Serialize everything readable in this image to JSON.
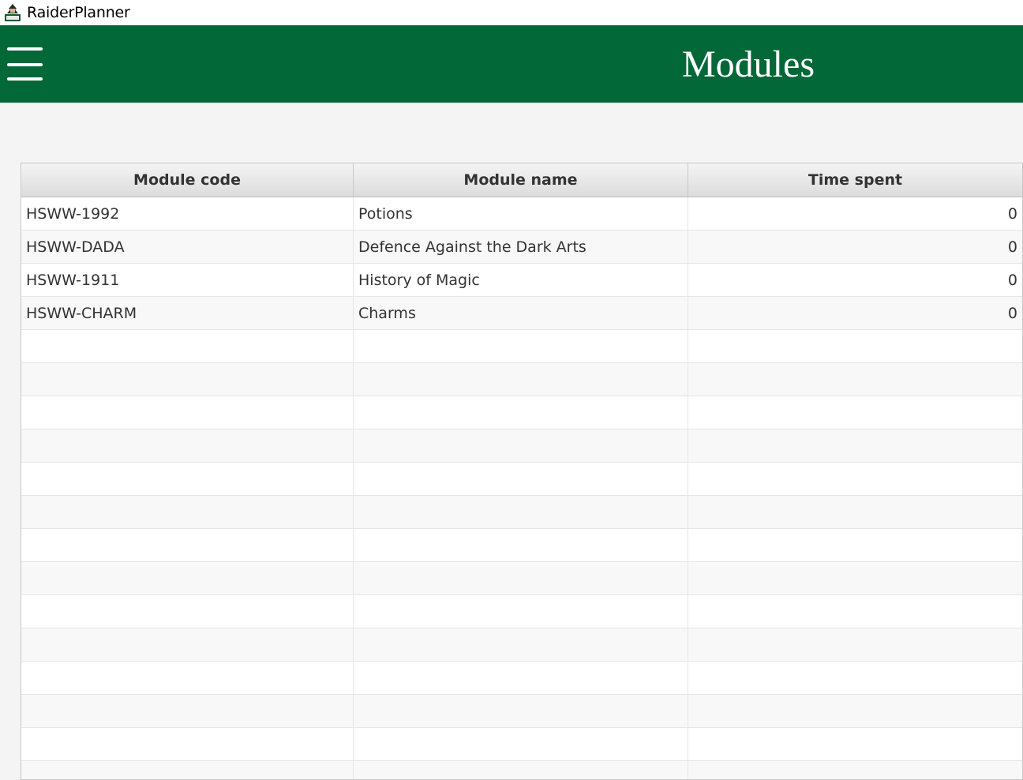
{
  "window": {
    "title": "RaiderPlanner",
    "icon": "raider-mascot-icon"
  },
  "header": {
    "menu_icon": "hamburger-menu-icon",
    "title": "Modules",
    "background_color": "#026837"
  },
  "table": {
    "columns": [
      "Module code",
      "Module name",
      "Time spent"
    ],
    "rows": [
      {
        "code": "HSWW-1992",
        "name": "Potions",
        "time": "0"
      },
      {
        "code": "HSWW-DADA",
        "name": "Defence Against the Dark Arts",
        "time": "0"
      },
      {
        "code": "HSWW-1911",
        "name": "History of Magic",
        "time": "0"
      },
      {
        "code": "HSWW-CHARM",
        "name": "Charms",
        "time": "0"
      }
    ]
  }
}
